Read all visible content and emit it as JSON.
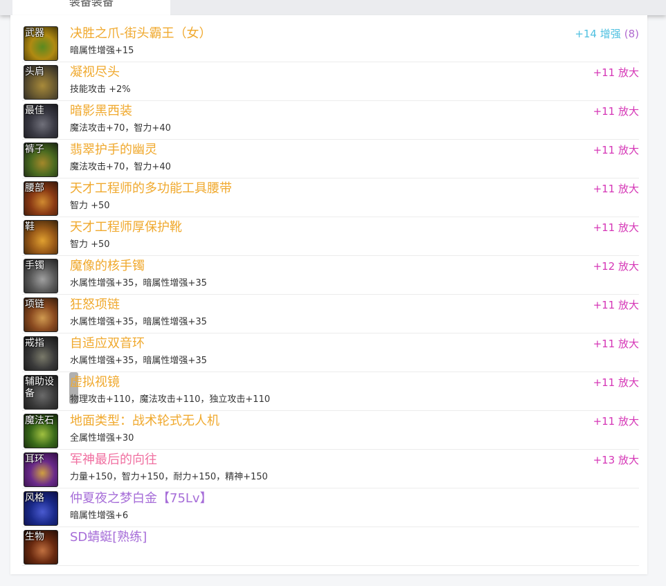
{
  "colors": {
    "name_gold": "#f0a92e",
    "name_pink": "#f06fa0",
    "name_purple": "#a66dd8",
    "enh_cyan": "#4fc0e0",
    "enh_magenta": "#d535b6",
    "count_purple": "#b06ad0"
  },
  "tabs": [
    "装备装备",
    "",
    "",
    ""
  ],
  "items": [
    {
      "slot": "武器",
      "name": "决胜之爪-街头霸王（女）",
      "stat": "暗属性增强+15",
      "enh": "+14 增强",
      "count": "(8)",
      "rarity": "gold",
      "enh_color": "cyan",
      "icon": "weapon-icon",
      "bg": [
        "#3b2e05",
        "#b08a12",
        "#5a8a20"
      ]
    },
    {
      "slot": "头肩",
      "name": "凝视尽头",
      "stat": "技能攻击 +2%",
      "enh": "+11 放大",
      "count": "",
      "rarity": "gold",
      "enh_color": "magenta",
      "icon": "shoulder-icon",
      "bg": [
        "#1c1c22",
        "#6a5a30",
        "#a88a3a"
      ]
    },
    {
      "slot": "最佳",
      "name": "暗影黑西装",
      "stat": "魔法攻击+70，智力+40",
      "enh": "+11 放大",
      "count": "",
      "rarity": "gold",
      "enh_color": "magenta",
      "icon": "top-armor-icon",
      "bg": [
        "#141418",
        "#3a3a44",
        "#70707a"
      ]
    },
    {
      "slot": "裤子",
      "name": "翡翠护手的幽灵",
      "stat": "魔法攻击+70，智力+40",
      "enh": "+11 放大",
      "count": "",
      "rarity": "gold",
      "enh_color": "magenta",
      "icon": "pants-icon",
      "bg": [
        "#111a10",
        "#4a6a20",
        "#a4882a"
      ]
    },
    {
      "slot": "腰部",
      "name": "天才工程师的多功能工具腰带",
      "stat": "智力 +50",
      "enh": "+11 放大",
      "count": "",
      "rarity": "gold",
      "enh_color": "magenta",
      "icon": "belt-icon",
      "bg": [
        "#2a1208",
        "#8a3a14",
        "#d08a30"
      ]
    },
    {
      "slot": "鞋",
      "name": "天才工程师厚保护靴",
      "stat": "智力 +50",
      "enh": "+11 放大",
      "count": "",
      "rarity": "gold",
      "enh_color": "magenta",
      "icon": "boots-icon",
      "bg": [
        "#2a1a08",
        "#9a5a18",
        "#e0a030"
      ]
    },
    {
      "slot": "手镯",
      "name": "魔像的核手镯",
      "stat": "水属性增强+35，暗属性增强+35",
      "enh": "+12 放大",
      "count": "",
      "rarity": "gold",
      "enh_color": "magenta",
      "icon": "bracelet-icon",
      "bg": [
        "#1a1a1a",
        "#5a5a5a",
        "#a0a0a0"
      ]
    },
    {
      "slot": "项链",
      "name": "狂怒项链",
      "stat": "水属性增强+35，暗属性增强+35",
      "enh": "+11 放大",
      "count": "",
      "rarity": "gold",
      "enh_color": "magenta",
      "icon": "necklace-icon",
      "bg": [
        "#2a1508",
        "#8a4a20",
        "#d09a50"
      ]
    },
    {
      "slot": "戒指",
      "name": "自适应双音环",
      "stat": "水属性增强+35，暗属性增强+35",
      "enh": "+11 放大",
      "count": "",
      "rarity": "gold",
      "enh_color": "magenta",
      "icon": "ring-icon",
      "bg": [
        "#101010",
        "#3a3a3a",
        "#7a7a6a"
      ]
    },
    {
      "slot": "辅助设备",
      "name": "虚拟视镜",
      "stat": "物理攻击+110，魔法攻击+110，独立攻击+110",
      "enh": "+11 放大",
      "count": "",
      "rarity": "gold",
      "enh_color": "magenta",
      "icon": "support-device-icon",
      "bg": [
        "#121212",
        "#3a3a3a",
        "#6a6a6a"
      ]
    },
    {
      "slot": "魔法石",
      "name": "地面类型：战术轮式无人机",
      "stat": "全属性增强+30",
      "enh": "+11 放大",
      "count": "",
      "rarity": "gold",
      "enh_color": "magenta",
      "icon": "magic-stone-icon",
      "bg": [
        "#0e1a08",
        "#3a6a1a",
        "#a0c040"
      ]
    },
    {
      "slot": "耳环",
      "name": "军神最后的向往",
      "stat": "力量+150，智力+150，耐力+150，精神+150",
      "enh": "+13 放大",
      "count": "",
      "rarity": "pink",
      "enh_color": "magenta",
      "icon": "earring-icon",
      "bg": [
        "#2a0a3a",
        "#6a2a8a",
        "#d0a040"
      ]
    },
    {
      "slot": "风格",
      "name": "仲夏夜之梦白金【75Lv】",
      "stat": "暗属性增强+6",
      "enh": "",
      "count": "",
      "rarity": "purple",
      "enh_color": "magenta",
      "icon": "style-icon",
      "bg": [
        "#0a0a3a",
        "#1a2a8a",
        "#4a5ad0"
      ]
    },
    {
      "slot": "生物",
      "name": "SD蜻蜓[熟练]",
      "stat": "",
      "enh": "",
      "count": "",
      "rarity": "purple",
      "enh_color": "magenta",
      "icon": "creature-icon",
      "bg": [
        "#1a0a05",
        "#6a2a10",
        "#c07040"
      ]
    }
  ]
}
